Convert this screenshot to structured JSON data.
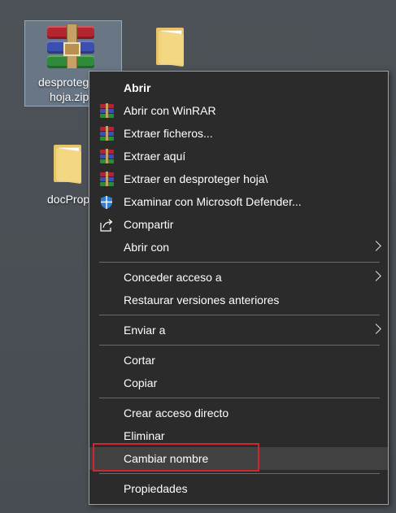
{
  "desktop": {
    "icons": [
      {
        "label_line1": "desprotege",
        "label_line2": "hoja.zip",
        "type": "winrar-archive-icon"
      },
      {
        "label_line1": "",
        "type": "folder-icon"
      },
      {
        "label_line1": "docProp",
        "type": "folder-icon"
      }
    ]
  },
  "context_menu": {
    "items": [
      {
        "label": "Abrir"
      },
      {
        "label": "Abrir con WinRAR",
        "icon": "winrar-icon"
      },
      {
        "label": "Extraer ficheros...",
        "icon": "winrar-icon"
      },
      {
        "label": "Extraer aquí",
        "icon": "winrar-icon"
      },
      {
        "label": "Extraer en desproteger hoja\\",
        "icon": "winrar-icon"
      },
      {
        "label": "Examinar con Microsoft Defender...",
        "icon": "defender-shield-icon"
      },
      {
        "label": "Compartir",
        "icon": "share-icon"
      },
      {
        "label": "Abrir con"
      },
      {
        "label": "Conceder acceso a"
      },
      {
        "label": "Restaurar versiones anteriores"
      },
      {
        "label": "Enviar a"
      },
      {
        "label": "Cortar"
      },
      {
        "label": "Copiar"
      },
      {
        "label": "Crear acceso directo"
      },
      {
        "label": "Eliminar"
      },
      {
        "label": "Cambiar nombre"
      },
      {
        "label": "Propiedades"
      }
    ]
  },
  "colors": {
    "menu_background": "#2b2b2b",
    "menu_hover": "#414141",
    "highlight_border": "#d0272f",
    "desktop_background": "#4a5055"
  }
}
